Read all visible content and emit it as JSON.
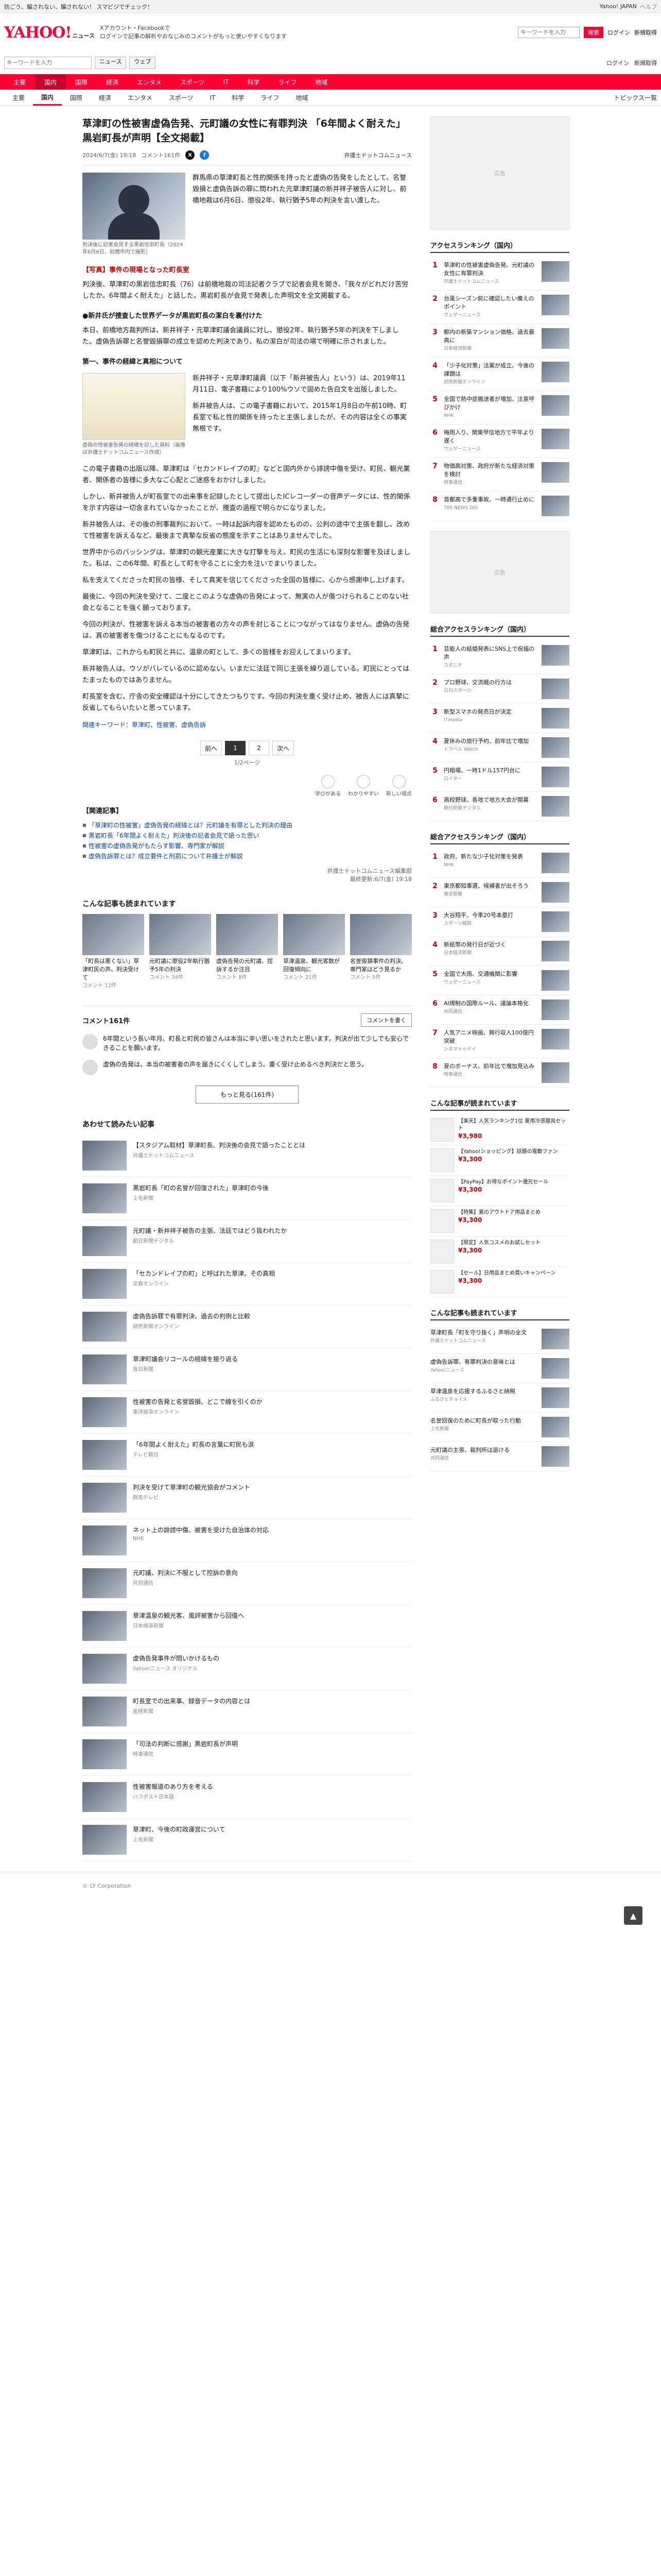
{
  "topbar": {
    "t1": "防ごう、騙されない、騙されない！ スマビジでチェック！",
    "help": "Yahoo! JAPAN",
    "help2": "ヘルプ"
  },
  "header": {
    "logo": "YAHOO!",
    "logo_sub": "ニュース",
    "notice1": "Xアカウント・Facebookで",
    "notice2": "ログインで記事の解析やおなじみのコメントがもっと使いやすくなります",
    "search_placeholder": "キーワードを入力",
    "search_btn": "検索",
    "login": "ログイン",
    "register": "新規取得"
  },
  "subbar": {
    "placeholder": "キーワードを入力",
    "btn1": "ニュース",
    "btn2": "ウェブ",
    "link1": "ログイン",
    "link2": "新規取得"
  },
  "nav": [
    "主要",
    "国内",
    "国際",
    "経済",
    "エンタメ",
    "スポーツ",
    "IT",
    "科学",
    "ライフ",
    "地域"
  ],
  "subnav": {
    "items": [
      "主要",
      "国内",
      "国際",
      "経済",
      "エンタメ",
      "スポーツ",
      "IT",
      "科学",
      "ライフ",
      "地域"
    ],
    "topics": "トピックス一覧"
  },
  "article": {
    "title": "草津町の性被害虚偽告発、元町議の女性に有罪判決 「6年間よく耐えた」黒岩町長が声明【全文掲載】",
    "date": "2024/6/7(金) 19:18",
    "comments": "コメント161件",
    "source": "弁護士ドットコムニュース",
    "lead": "群馬県の草津町長と性的関係を持ったと虚偽の告発をしたとして、名誉毀損と虚偽告訴の罪に問われた元草津町議の新井祥子被告人に対し、前橋地裁は6月6日、懲役2年、執行猶予5年の判決を言い渡した。",
    "photo_caption": "判決後に記者会見する黒岩信忠町長（2024年6月6日、前橋市内で撮影）",
    "section1": "【写真】事件の現場となった町長室",
    "p1": "判決後、草津町の黒岩信忠町長（76）は前橋地裁の司法記者クラブで記者会見を開き、「我々がどれだけ苦労したか。6年間よく耐えた」と話した。黒岩町長が会見で発表した声明文を全文掲載する。",
    "bullet": "●新井氏が捜査した世界データが黒岩町長の潔白を裏付けた",
    "p2": "本日、前橋地方裁判所は、新井祥子・元草津町議会議員に対し、懲役2年、執行猶予5年の判決を下しました。虚偽告訴罪と名誉毀損罪の成立を認めた判決であり、私の潔白が司法の場で明確に示されました。",
    "section2": "第一、事件の経緯と真相について",
    "doc_caption": "虚偽の性被害告発の経緯を記した資料（画像は弁護士ドットコムニュース作成）",
    "p3": "新井祥子・元草津町議員（以下「新井被告人」という）は、2019年11月11日、電子書籍により100%ウソで固めた告白文を出版しました。",
    "p4": "新井被告人は、この電子書籍において、2015年1月8日の午前10時、町長室で私と性的関係を持ったと主張しましたが、その内容は全くの事実無根です。",
    "p5": "この電子書籍の出版以降、草津町は『セカンドレイプの町』などと国内外から誹謗中傷を受け、町民、観光業者、関係者の皆様に多大なご心配とご迷惑をおかけしました。",
    "p6": "しかし、新井被告人が町長室での出来事を記録したとして提出したICレコーダーの音声データには、性的関係を示す内容は一切含まれていなかったことが、捜査の過程で明らかになりました。",
    "p7": "新井被告人は、その後の刑事裁判において、一時は起訴内容を認めたものの、公判の途中で主張を翻し、改めて性被害を訴えるなど、最後まで真摯な反省の態度を示すことはありませんでした。",
    "p8": "世界中からのバッシングは、草津町の観光産業に大きな打撃を与え、町民の生活にも深刻な影響を及ぼしました。私は、この6年間、町長として町を守ることに全力を注いでまいりました。",
    "p9": "私を支えてくださった町民の皆様、そして真実を信じてくださった全国の皆様に、心から感謝申し上げます。",
    "p10": "最後に、今回の判決を受けて、二度とこのような虚偽の告発によって、無実の人が傷つけられることのない社会となることを強く願っております。",
    "p11": "今回の判決が、性被害を訴える本当の被害者の方々の声を封じることにつながってはなりません。虚偽の告発は、真の被害者を傷つけることにもなるのです。",
    "p12": "草津町は、これからも町民と共に、温泉の町として、多くの皆様をお迎えしてまいります。",
    "p13": "新井被告人は、ウソがバレているのに認めない。いまだに法廷で同じ主張を繰り返している。町民にとってはたまったものではありません。",
    "p14": "町長室を含む、庁舎の安全確認は十分にしてきたつもりです。今回の判決を重く受け止め、被告人には真摯に反省してもらいたいと思っています。",
    "tags": "関連キーワード：草津町、性被害、虚偽告訴",
    "pager": {
      "prev": "前へ",
      "p1": "1",
      "p2": "2",
      "next": "次へ",
      "count": "1/2ページ"
    },
    "reactions": [
      "学びがある",
      "わかりやすい",
      "新しい視点"
    ],
    "related_head": "【関連記事】",
    "related": [
      "「草津町の性被害」虚偽告発の経緯とは？元町議を有罪とした判決の理由",
      "黒岩町長「6年間よく耐えた」判決後の記者会見で語った思い",
      "性被害の虚偽告発がもたらす影響、専門家が解説",
      "虚偽告訴罪とは？成立要件と刑罰について弁護士が解説"
    ],
    "end_byline": "弁護士ドットコムニュース編集部",
    "end_date": "最終更新:6/7(金) 19:18"
  },
  "picks": {
    "title": "こんな記事も読まれています",
    "items": [
      {
        "text": "「町長は悪くない」草津町民の声、判決受けて",
        "meta": "コメント 12件"
      },
      {
        "text": "元町議に懲役2年執行猶予5年の判決",
        "meta": "コメント 34件"
      },
      {
        "text": "虚偽告発の元町議、控訴するか注目",
        "meta": "コメント 8件"
      },
      {
        "text": "草津温泉、観光客数が回復傾向に",
        "meta": "コメント 21件"
      },
      {
        "text": "名誉毀損事件の判決、専門家はどう見るか",
        "meta": "コメント 5件"
      }
    ]
  },
  "comments": {
    "title": "コメント161件",
    "btn": "コメントを書く",
    "items": [
      {
        "text": "6年間という長い年月、町長と町民の皆さんは本当に辛い思いをされたと思います。判決が出て少しでも安心できることを願います。"
      },
      {
        "text": "虚偽の告発は、本当の被害者の声を届きにくくしてしまう。重く受け止めるべき判決だと思う。"
      }
    ],
    "more": "もっと見る(161件)"
  },
  "morelist": {
    "title": "あわせて読みたい記事",
    "items": [
      {
        "text": "【スタジアム取材】草津町長、判決後の会見で語ったこととは",
        "src": "弁護士ドットコムニュース"
      },
      {
        "text": "黒岩町長「町の名誉が回復された」草津町の今後",
        "src": "上毛新聞"
      },
      {
        "text": "元町議・新井祥子被告の主張、法廷ではどう扱われたか",
        "src": "朝日新聞デジタル"
      },
      {
        "text": "「セカンドレイプの町」と呼ばれた草津、その真相",
        "src": "文春オンライン"
      },
      {
        "text": "虚偽告訴罪で有罪判決、過去の判例と比較",
        "src": "読売新聞オンライン"
      },
      {
        "text": "草津町議会リコールの経緯を振り返る",
        "src": "毎日新聞"
      },
      {
        "text": "性被害の告発と名誉毀損、どこで線を引くのか",
        "src": "東洋経済オンライン"
      },
      {
        "text": "「6年間よく耐えた」町長の言葉に町民も涙",
        "src": "テレビ朝日"
      },
      {
        "text": "判決を受けて草津町の観光協会がコメント",
        "src": "群馬テレビ"
      },
      {
        "text": "ネット上の誹謗中傷、被害を受けた自治体の対応",
        "src": "NHK"
      },
      {
        "text": "元町議、判決に不服として控訴の意向",
        "src": "共同通信"
      },
      {
        "text": "草津温泉の観光客、風評被害から回復へ",
        "src": "日本経済新聞"
      },
      {
        "text": "虚偽告発事件が問いかけるもの",
        "src": "Yahoo!ニュース オリジナル"
      },
      {
        "text": "町長室での出来事、録音データの内容とは",
        "src": "産経新聞"
      },
      {
        "text": "「司法の判断に感謝」黒岩町長が声明",
        "src": "時事通信"
      },
      {
        "text": "性被害報道のあり方を考える",
        "src": "ハフポスト日本版"
      },
      {
        "text": "草津町、今後の町政運営について",
        "src": "上毛新聞"
      }
    ]
  },
  "side": {
    "ad": "広告",
    "rank_title": "アクセスランキング（国内）",
    "rank": [
      {
        "no": "1",
        "text": "草津町の性被害虚偽告発、元町議の女性に有罪判決",
        "src": "弁護士ドットコムニュース"
      },
      {
        "no": "2",
        "text": "台風シーズン前に確認したい備えのポイント",
        "src": "ウェザーニュース"
      },
      {
        "no": "3",
        "text": "都内の新築マンション価格、過去最高に",
        "src": "日本経済新聞"
      },
      {
        "no": "4",
        "text": "「少子化対策」法案が成立、今後の課題は",
        "src": "読売新聞オンライン"
      },
      {
        "no": "5",
        "text": "全国で熱中症搬送者が増加、注意呼びかけ",
        "src": "NHK"
      },
      {
        "no": "6",
        "text": "梅雨入り、関東甲信地方で平年より遅く",
        "src": "ウェザーニュース"
      },
      {
        "no": "7",
        "text": "物価高対策、政府が新たな経済対策を検討",
        "src": "時事通信"
      },
      {
        "no": "8",
        "text": "首都高で多重事故、一時通行止めに",
        "src": "TBS NEWS DIG"
      }
    ],
    "rank2_title": "総合アクセスランキング（国内）",
    "rank2": [
      {
        "no": "1",
        "text": "芸能人の結婚発表にSNS上で祝福の声",
        "src": "スポニチ"
      },
      {
        "no": "2",
        "text": "プロ野球、交流戦の行方は",
        "src": "日刊スポーツ"
      },
      {
        "no": "3",
        "text": "新型スマホの発売日が決定",
        "src": "ITmedia"
      },
      {
        "no": "4",
        "text": "夏休みの旅行予約、前年比で増加",
        "src": "トラベル Watch"
      },
      {
        "no": "5",
        "text": "円相場、一時1ドル157円台に",
        "src": "ロイター"
      },
      {
        "no": "6",
        "text": "高校野球、各地で地方大会が開幕",
        "src": "朝日新聞デジタル"
      }
    ],
    "rank3_title": "総合アクセスランキング（国内）",
    "rank3": [
      {
        "no": "1",
        "text": "政府、新たな少子化対策を発表",
        "src": "NHK"
      },
      {
        "no": "2",
        "text": "東京都知事選、候補者が出そろう",
        "src": "東京新聞"
      },
      {
        "no": "3",
        "text": "大谷翔平、今季20号本塁打",
        "src": "スポーツ報知"
      },
      {
        "no": "4",
        "text": "新紙幣の発行日が近づく",
        "src": "日本経済新聞"
      },
      {
        "no": "5",
        "text": "全国で大雨、交通機関に影響",
        "src": "ウェザーニュース"
      },
      {
        "no": "6",
        "text": "AI規制の国際ルール、議論本格化",
        "src": "共同通信"
      },
      {
        "no": "7",
        "text": "人気アニメ映画、興行収入100億円突破",
        "src": "シネマトゥデイ"
      },
      {
        "no": "8",
        "text": "夏のボーナス、前年比で増加見込み",
        "src": "時事通信"
      }
    ],
    "shop_title": "こんな記事が読まれています",
    "shop": [
      {
        "text": "【楽天】人気ランキング1位 夏用冷感寝具セット",
        "price": "¥3,980"
      },
      {
        "text": "【Yahoo!ショッピング】話題の電動ファン",
        "price": "¥3,300"
      },
      {
        "text": "【PayPay】お得なポイント還元セール",
        "price": "¥3,300"
      },
      {
        "text": "【特集】夏のアウトドア用品まとめ",
        "price": "¥3,300"
      },
      {
        "text": "【限定】人気コスメのお試しセット",
        "price": "¥3,300"
      },
      {
        "text": "【セール】日用品まとめ買いキャンペーン",
        "price": "¥3,300"
      }
    ],
    "side_more_title": "こんな記事も読まれています",
    "side_more": [
      {
        "text": "草津町長「町を守り抜く」声明の全文",
        "src": "弁護士ドットコムニュース"
      },
      {
        "text": "虚偽告訴罪、有罪判決の意味とは",
        "src": "Yahoo!ニュース"
      },
      {
        "text": "草津温泉を応援するふるさと納税",
        "src": "ふるさとチョイス"
      },
      {
        "text": "名誉回復のために町長が取った行動",
        "src": "上毛新聞"
      },
      {
        "text": "元町議の主張、裁判所は退ける",
        "src": "共同通信"
      }
    ]
  },
  "footer": "© LY Corporation"
}
